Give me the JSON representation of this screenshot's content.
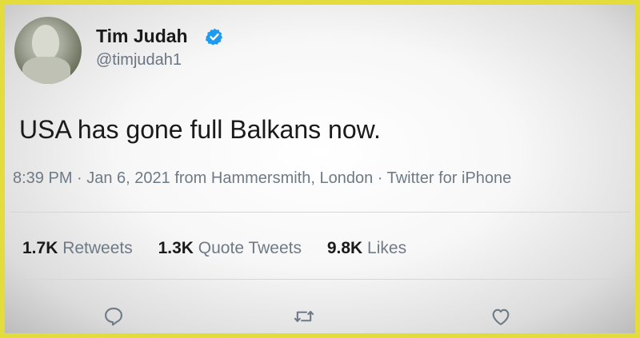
{
  "author": {
    "name": "Tim Judah",
    "handle": "@timjudah1",
    "verified": true,
    "avatar": "avatar-statue-photo"
  },
  "tweet": {
    "text": "USA has gone full Balkans now.",
    "meta": "8:39 PM · Jan 6, 2021 from Hammersmith, London · Twitter for iPhone"
  },
  "stats": [
    {
      "count": "1.7K",
      "label": "Retweets"
    },
    {
      "count": "1.3K",
      "label": "Quote Tweets"
    },
    {
      "count": "9.8K",
      "label": "Likes"
    }
  ],
  "actions": {
    "reply": "reply-icon",
    "retweet": "retweet-icon",
    "like": "like-icon"
  },
  "colors": {
    "frame": "#e2dc3c",
    "verified": "#1d9bf0",
    "secondary_text": "#6e7a86",
    "primary_text": "#1a1a1a"
  }
}
